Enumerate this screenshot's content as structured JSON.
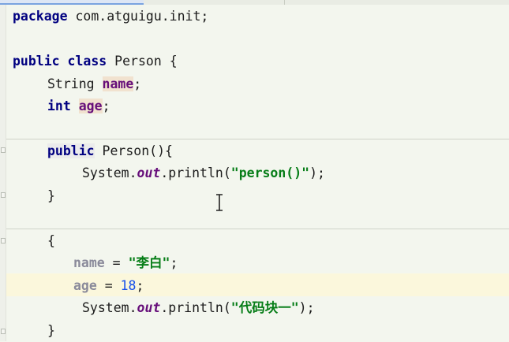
{
  "editor": {
    "lines": {
      "l1": {
        "kw": "package",
        "rest": " com.atguigu.init;"
      },
      "l3": {
        "kw1": "public",
        "kw2": "class",
        "rest": " Person {"
      },
      "l4": {
        "type": "String",
        "field": "name",
        "end": ";"
      },
      "l5": {
        "type": "int",
        "field": "age",
        "end": ";"
      },
      "l7": {
        "kw": "public",
        "rest": " Person(){"
      },
      "l8": {
        "a": "System.",
        "out": "out",
        "b": ".println(",
        "str": "\"person()\"",
        "c": ");"
      },
      "l9": {
        "text": "}"
      },
      "l11": {
        "text": "{"
      },
      "l12": {
        "field": "name",
        "op": " = ",
        "str": "\"李白\"",
        "end": ";"
      },
      "l13": {
        "field": "age",
        "op": " = ",
        "num": "18",
        "end": ";"
      },
      "l14": {
        "a": "System.",
        "out": "out",
        "b": ".println(",
        "str": "\"代码块一\"",
        "c": ");"
      },
      "l15": {
        "text": "}"
      }
    }
  }
}
